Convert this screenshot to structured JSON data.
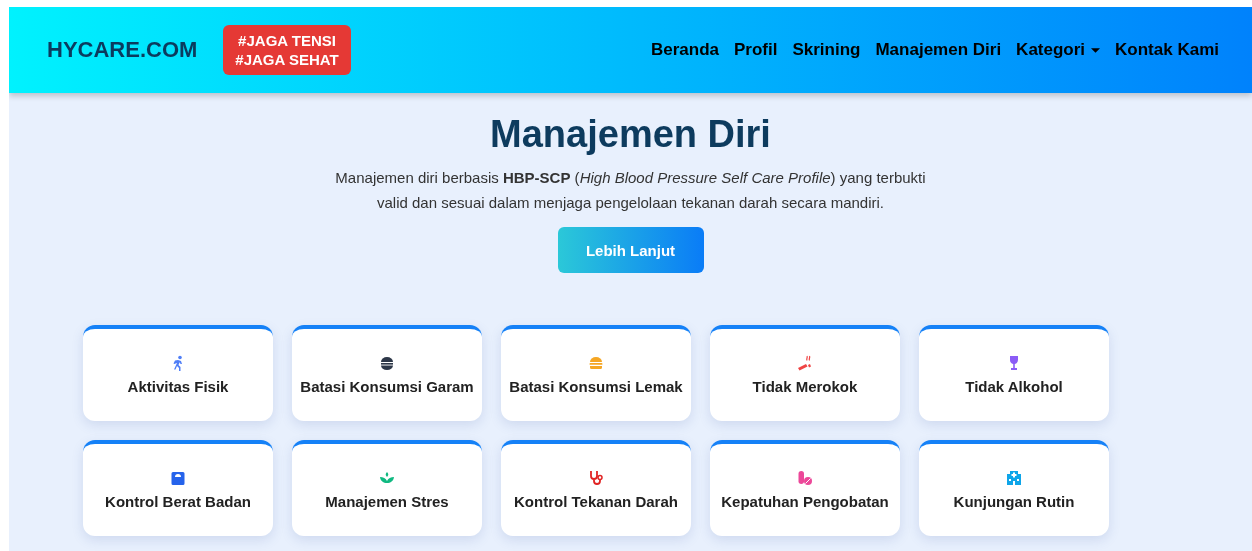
{
  "navbar": {
    "brand": "HYCARE.COM",
    "badge_lines": [
      "#JAGA TENSI",
      "#JAGA SEHAT"
    ],
    "links": [
      {
        "label": "Beranda",
        "dropdown": false
      },
      {
        "label": "Profil",
        "dropdown": false
      },
      {
        "label": "Skrining",
        "dropdown": false
      },
      {
        "label": "Manajemen Diri",
        "dropdown": false
      },
      {
        "label": "Kategori",
        "dropdown": true
      },
      {
        "label": "Kontak Kami",
        "dropdown": false
      }
    ]
  },
  "hero": {
    "title": "Manajemen Diri",
    "description": "Manajemen diri berbasis **HBP-SCP** (*High Blood Pressure Self Care Profile*) yang terbukti valid dan sesuai dalam menjaga pengelolaan tekanan darah secara mandiri.",
    "button": "Lebih Lanjut"
  },
  "cards": [
    {
      "label": "Aktivitas Fisik",
      "kind": "runner",
      "color": "#4f7ef7"
    },
    {
      "label": "Batasi Konsumsi Garam",
      "kind": "salt",
      "color": "#2d3748"
    },
    {
      "label": "Batasi Konsumsi Lemak",
      "kind": "burger",
      "color": "#f5a623"
    },
    {
      "label": "Tidak Merokok",
      "kind": "smoking",
      "color": "#ef4444"
    },
    {
      "label": "Tidak Alkohol",
      "kind": "wine",
      "color": "#8b5cf6"
    },
    {
      "label": "Kontrol Berat Badan",
      "kind": "scale",
      "color": "#2563eb"
    },
    {
      "label": "Manajemen Stres",
      "kind": "lotus",
      "color": "#10b981"
    },
    {
      "label": "Kontrol Tekanan Darah",
      "kind": "stethoscope",
      "color": "#e02424"
    },
    {
      "label": "Kepatuhan Pengobatan",
      "kind": "pills",
      "color": "#ec4899"
    },
    {
      "label": "Kunjungan Rutin",
      "kind": "hospital",
      "color": "#0ea5e9"
    }
  ]
}
